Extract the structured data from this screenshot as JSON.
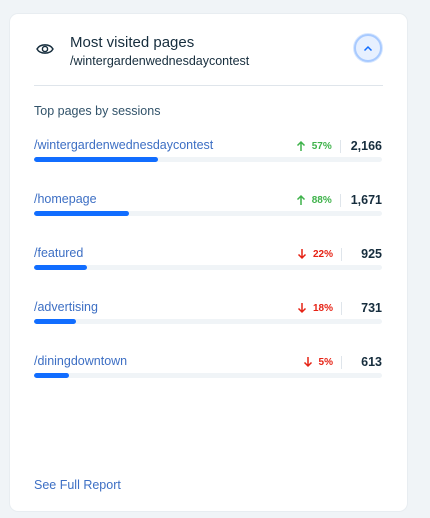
{
  "widget": {
    "title": "Most visited pages",
    "subtitle": "/wintergardenwednesdaycontest",
    "section_label": "Top pages by sessions",
    "footer_link": "See Full Report",
    "colors": {
      "accent": "#116dff",
      "link": "#3d6fc4",
      "up": "#3eb24a",
      "down": "#e62214"
    }
  },
  "pages": [
    {
      "path": "/wintergardenwednesdaycontest",
      "trend": "up",
      "change": "57%",
      "sessions": "2,166",
      "share": 0.355
    },
    {
      "path": "/homepage",
      "trend": "up",
      "change": "88%",
      "sessions": "1,671",
      "share": 0.274
    },
    {
      "path": "/featured",
      "trend": "down",
      "change": "22%",
      "sessions": "925",
      "share": 0.152
    },
    {
      "path": "/advertising",
      "trend": "down",
      "change": "18%",
      "sessions": "731",
      "share": 0.12
    },
    {
      "path": "/diningdowntown",
      "trend": "down",
      "change": "5%",
      "sessions": "613",
      "share": 0.1
    }
  ]
}
